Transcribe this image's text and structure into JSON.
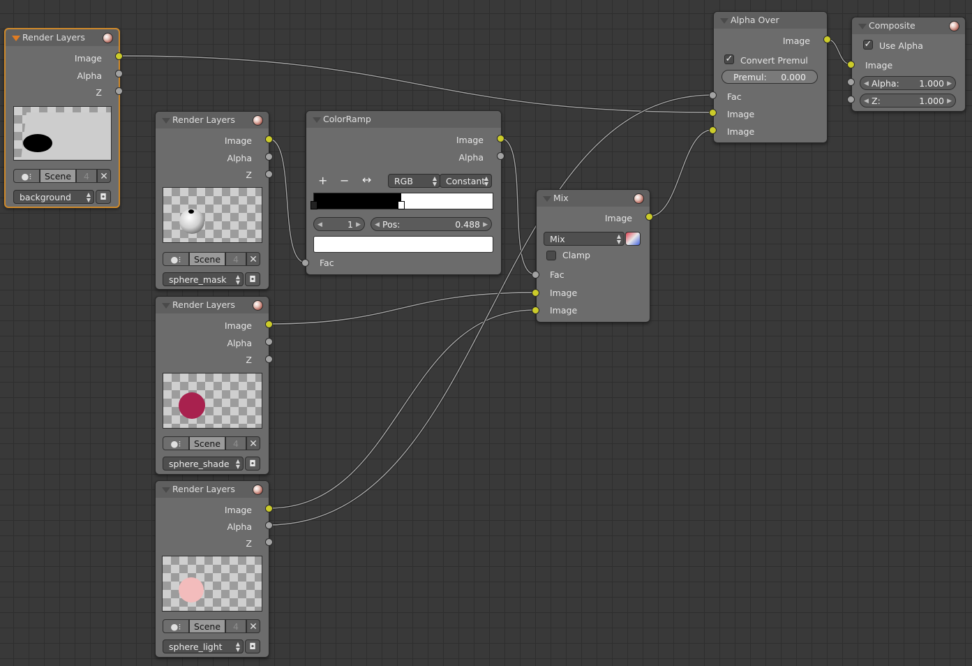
{
  "nodes": {
    "rl_background": {
      "title": "Render Layers",
      "outputs": [
        "Image",
        "Alpha",
        "Z"
      ],
      "scene": "Scene",
      "scene_users": "4",
      "layer": "background"
    },
    "rl_sphere_mask": {
      "title": "Render Layers",
      "outputs": [
        "Image",
        "Alpha",
        "Z"
      ],
      "scene": "Scene",
      "scene_users": "4",
      "layer": "sphere_mask"
    },
    "rl_sphere_shade": {
      "title": "Render Layers",
      "outputs": [
        "Image",
        "Alpha",
        "Z"
      ],
      "scene": "Scene",
      "scene_users": "4",
      "layer": "sphere_shade"
    },
    "rl_sphere_light": {
      "title": "Render Layers",
      "outputs": [
        "Image",
        "Alpha",
        "Z"
      ],
      "scene": "Scene",
      "scene_users": "4",
      "layer": "sphere_light"
    },
    "colorramp": {
      "title": "ColorRamp",
      "outputs": [
        "Image",
        "Alpha"
      ],
      "add_icon": "+",
      "remove_icon": "−",
      "flip_icon": "↔",
      "color_mode": "RGB",
      "interpolation": "Constant",
      "active_stop": "1",
      "pos_label": "Pos:",
      "pos_value": "0.488",
      "input": "Fac"
    },
    "mix": {
      "title": "Mix",
      "output": "Image",
      "blend_type": "Mix",
      "clamp_label": "Clamp",
      "clamp_checked": false,
      "inputs": [
        "Fac",
        "Image",
        "Image"
      ]
    },
    "alpha_over": {
      "title": "Alpha Over",
      "output": "Image",
      "convert_premul_label": "Convert Premul",
      "convert_premul_checked": true,
      "premul_label": "Premul:",
      "premul_value": "0.000",
      "inputs": [
        "Fac",
        "Image",
        "Image"
      ]
    },
    "composite": {
      "title": "Composite",
      "use_alpha_label": "Use Alpha",
      "use_alpha_checked": true,
      "input": "Image",
      "alpha_label": "Alpha:",
      "alpha_value": "1.000",
      "z_label": "Z:",
      "z_value": "1.000"
    }
  },
  "icons": {
    "node_preview_toggle": "material-ball-icon",
    "scene_browse": "scene-icon",
    "scene_unlink": "x-icon",
    "render_layer": "camera-icon",
    "checkmark": "✓"
  },
  "colors": {
    "canvas": "#393939",
    "node_body": "#6c6c6c",
    "active_outline": "#d08a2a",
    "socket_color": "#cccc2a",
    "socket_value": "#a3a3a3",
    "wire": "#a8a8a8",
    "sphere_shade": "#a8214e",
    "sphere_light": "#f3bcbc"
  }
}
